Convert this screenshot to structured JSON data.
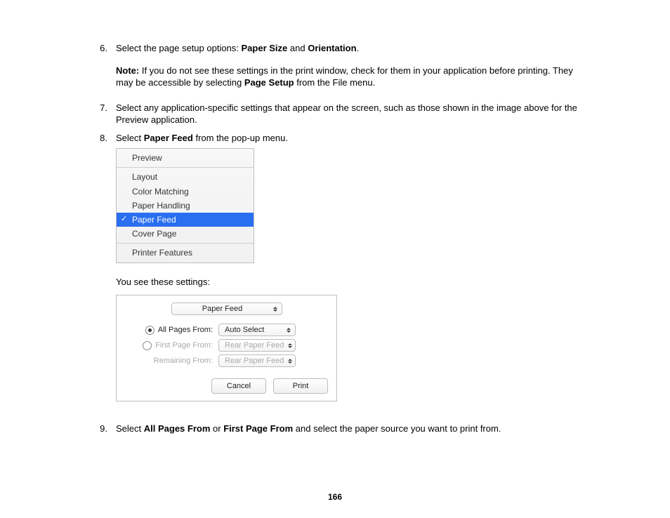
{
  "steps": {
    "s6": {
      "num": "6.",
      "text_a": "Select the page setup options: ",
      "b1": "Paper Size",
      "mid": " and ",
      "b2": "Orientation",
      "text_b": "."
    },
    "note": {
      "label": "Note:",
      "text_a": " If you do not see these settings in the print window, check for them in your application before printing. They may be accessible by selecting ",
      "b1": "Page Setup",
      "text_b": " from the File menu."
    },
    "s7": {
      "num": "7.",
      "text": "Select any application-specific settings that appear on the screen, such as those shown in the image above for the Preview application."
    },
    "s8": {
      "num": "8.",
      "text_a": "Select ",
      "b1": "Paper Feed",
      "text_b": " from the pop-up menu."
    },
    "lead": "You see these settings:",
    "s9": {
      "num": "9.",
      "text_a": "Select ",
      "b1": "All Pages From",
      "mid": " or ",
      "b2": "First Page From",
      "text_b": " and select the paper source you want to print from."
    }
  },
  "menu": {
    "preview": "Preview",
    "layout": "Layout",
    "color": "Color Matching",
    "handling": "Paper Handling",
    "feed": "Paper Feed",
    "cover": "Cover Page",
    "features": "Printer Features"
  },
  "panel": {
    "top_select": "Paper Feed",
    "all_label": "All Pages From:",
    "all_value": "Auto Select",
    "first_label": "First Page From:",
    "first_value": "Rear Paper Feed",
    "remain_label": "Remaining From:",
    "remain_value": "Rear Paper Feed",
    "cancel": "Cancel",
    "print": "Print"
  },
  "page_number": "166"
}
